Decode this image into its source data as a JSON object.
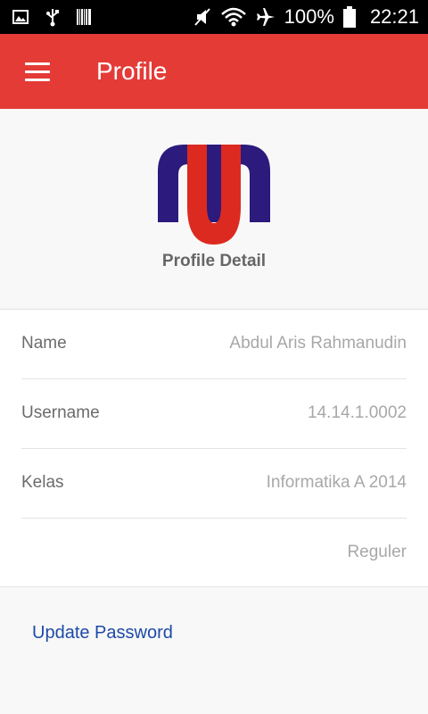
{
  "status_bar": {
    "battery": "100%",
    "time": "22:21",
    "icons": [
      "gallery-icon",
      "usb-icon",
      "barcode-icon",
      "mute-icon",
      "wifi-icon",
      "airplane-icon",
      "battery-icon"
    ]
  },
  "app_bar": {
    "title": "Profile",
    "color": "#e43b37"
  },
  "header": {
    "logo": "u-m-logo",
    "subtitle": "Profile Detail"
  },
  "details": {
    "rows": [
      {
        "label": "Name",
        "value": "Abdul Aris Rahmanudin"
      },
      {
        "label": "Username",
        "value": "14.14.1.0002"
      },
      {
        "label": "Kelas",
        "value": "Informatika A 2014"
      },
      {
        "label": "",
        "value": "Reguler"
      }
    ]
  },
  "actions": {
    "update_password": "Update Password",
    "link_color": "#1e4aa8"
  }
}
